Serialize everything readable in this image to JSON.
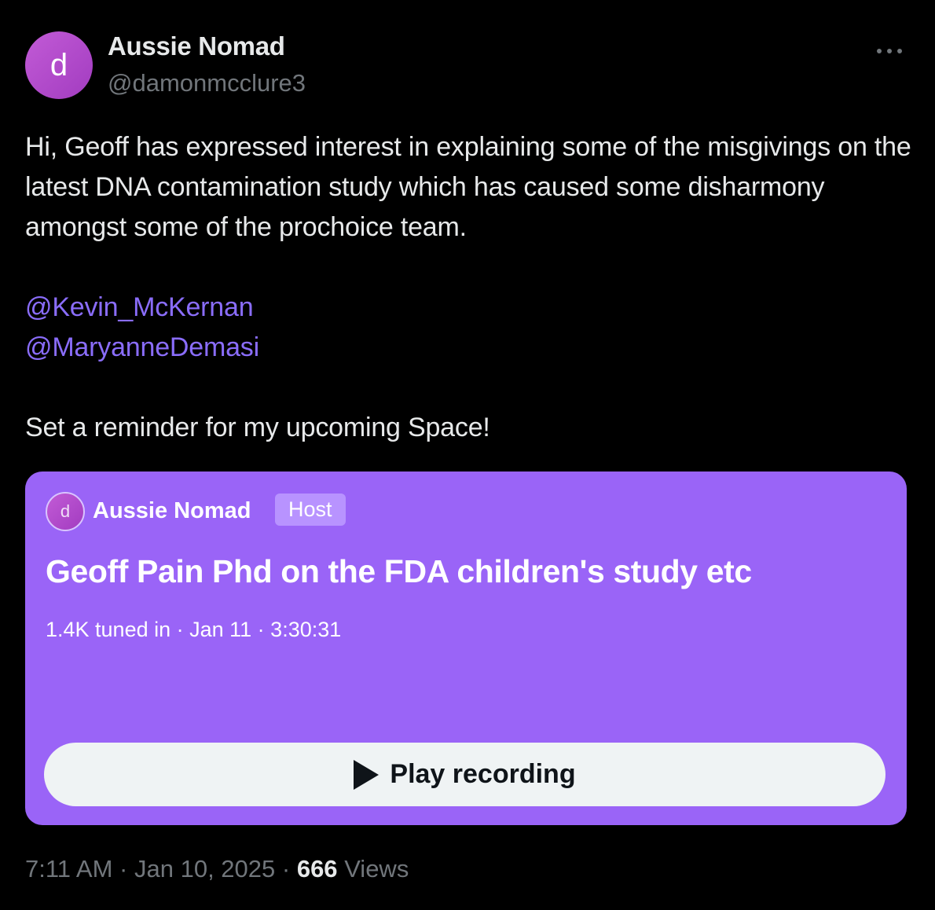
{
  "author": {
    "avatar_letter": "d",
    "name": "Aussie Nomad",
    "handle": "@damonmcclure3"
  },
  "tweet": {
    "text_paragraph": "Hi, Geoff has expressed interest in explaining some of the misgivings on the latest DNA contamination study which has caused some disharmony amongst some of the prochoice team.",
    "mentions": [
      "@Kevin_McKernan",
      "@MaryanneDemasi"
    ],
    "reminder_text": "Set a reminder for my upcoming Space!"
  },
  "space_card": {
    "host_avatar_letter": "d",
    "host_name": "Aussie Nomad",
    "host_badge": "Host",
    "title": "Geoff Pain Phd on the FDA children's study etc",
    "meta": "1.4K tuned in · Jan 11 · 3:30:31",
    "play_label": "Play recording",
    "background_color": "#9a64f7"
  },
  "footer": {
    "time": "7:11 AM",
    "date": "Jan 10, 2025",
    "separator": " · ",
    "views_count": "666",
    "views_label": "Views"
  },
  "icons": {
    "more": "more-horizontal-icon",
    "play": "play-icon"
  },
  "colors": {
    "background": "#000000",
    "text": "#e7e9ea",
    "secondary_text": "#71767b",
    "mention": "#8a6dfb"
  }
}
